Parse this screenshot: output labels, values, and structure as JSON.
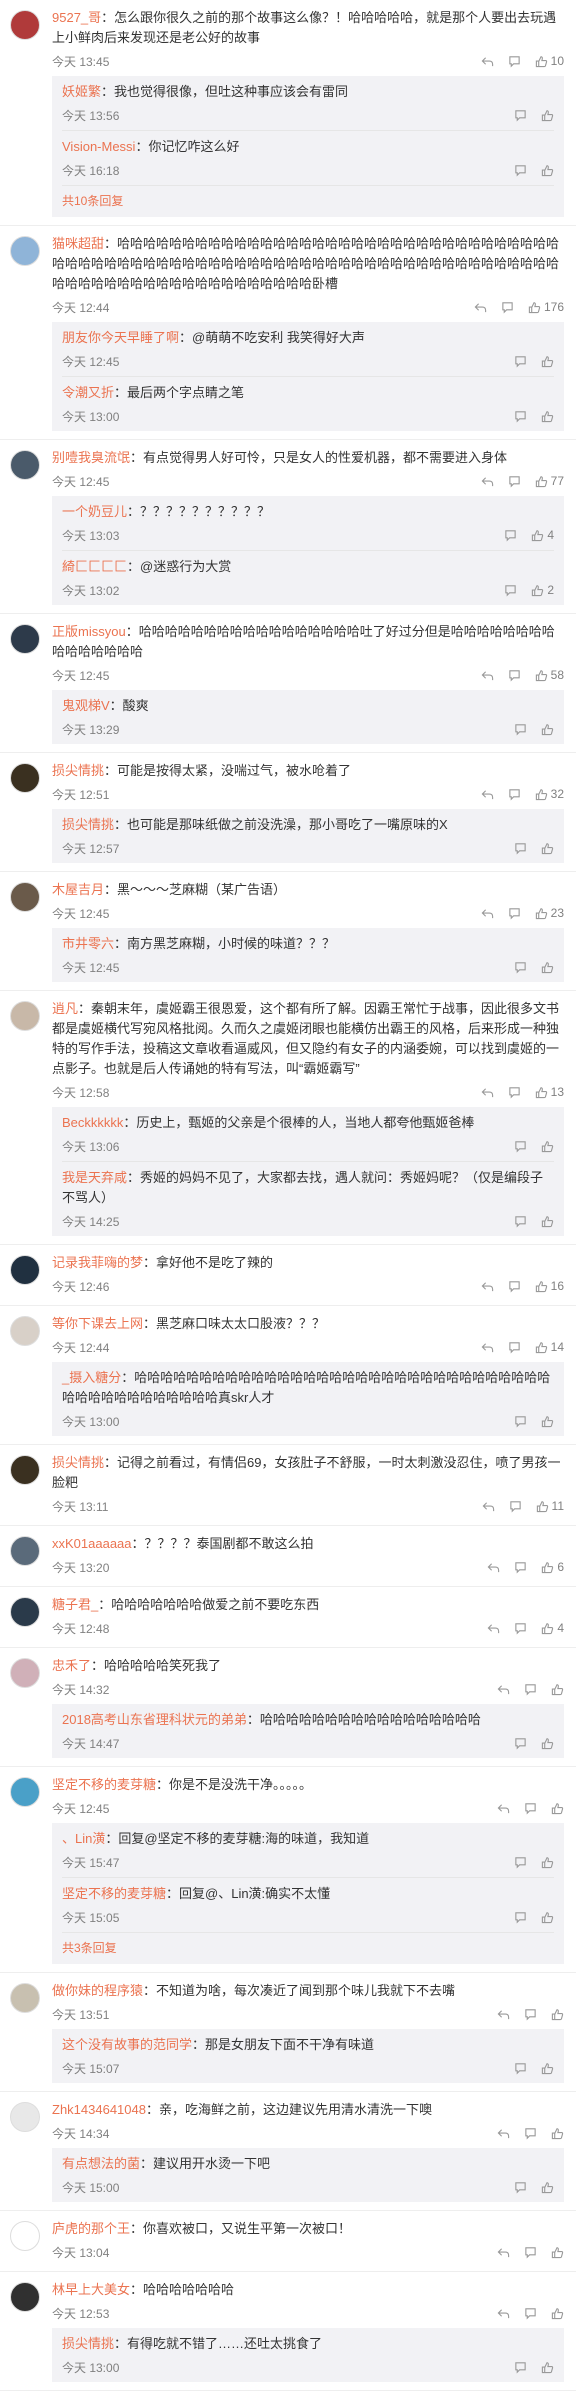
{
  "icons": {
    "reply": "reply-icon",
    "more": "more-icon",
    "like": "thumb-up-icon"
  },
  "comments": [
    {
      "user": "9527_哥",
      "text": "：怎么跟你很久之前的那个故事这么像？！哈哈哈哈哈，就是那个人要出去玩遇上小鲜肉后来发现还是老公好的故事",
      "time": "今天 13:45",
      "likes": "10",
      "avatar_color": "#b03a3a",
      "replies": [
        {
          "user": "妖姬繁",
          "text": "：我也觉得很像，但吐这种事应该会有雷同",
          "time": "今天 13:56"
        },
        {
          "user": "Vision-Messi",
          "text": "：你记忆咋这么好",
          "time": "今天 16:18"
        }
      ],
      "more": "共10条回复"
    },
    {
      "user": "猫咪超甜",
      "text": "：哈哈哈哈哈哈哈哈哈哈哈哈哈哈哈哈哈哈哈哈哈哈哈哈哈哈哈哈哈哈哈哈哈哈哈哈哈哈哈哈哈哈哈哈哈哈哈哈哈哈哈哈哈哈哈哈哈哈哈哈哈哈哈哈哈哈哈哈哈哈哈哈哈哈哈哈哈哈哈哈哈哈哈哈哈哈哈哈哈哈哈哈哈卧槽",
      "time": "今天 12:44",
      "likes": "176",
      "avatar_color": "#8fb4d8",
      "replies": [
        {
          "user": "朋友你今天早睡了啊",
          "text": "：@萌萌不吃安利 我笑得好大声",
          "time": "今天 12:45"
        },
        {
          "user": "令潮又折",
          "text": "：最后两个字点睛之笔",
          "time": "今天 13:00"
        }
      ],
      "more": ""
    },
    {
      "user": "别噎我臭流氓",
      "text": "：有点觉得男人好可怜，只是女人的性爱机器，都不需要进入身体",
      "time": "今天 12:45",
      "likes": "77",
      "avatar_color": "#4a5a6a",
      "replies": [
        {
          "user": "一个奶豆儿",
          "text": "：？？？？？？？？？？",
          "time": "今天 13:03",
          "likes": "4"
        },
        {
          "user": "綺匚匚匚匚",
          "text": "：@迷惑行为大赏",
          "time": "今天 13:02",
          "likes": "2"
        }
      ],
      "more": ""
    },
    {
      "user": "正版missyou",
      "text": "：哈哈哈哈哈哈哈哈哈哈哈哈哈哈哈哈哈吐了好过分但是哈哈哈哈哈哈哈哈哈哈哈哈哈哈哈",
      "time": "今天 12:45",
      "likes": "58",
      "avatar_color": "#2d3a4a",
      "replies": [
        {
          "user": "鬼观梯V",
          "text": "：酸爽",
          "time": "今天 13:29"
        }
      ],
      "more": ""
    },
    {
      "user": "损尖情挑",
      "text": "：可能是按得太紧，没喘过气，被水呛着了",
      "time": "今天 12:51",
      "likes": "32",
      "avatar_color": "#3a3020",
      "replies": [
        {
          "user": "损尖情挑",
          "text": "：也可能是那味纸做之前没洗澡，那小哥吃了一嘴原味的X",
          "time": "今天 12:57"
        }
      ],
      "more": ""
    },
    {
      "user": "木屋吉月",
      "text": "：黑～～～芝麻糊（某广告语）",
      "time": "今天 12:45",
      "likes": "23",
      "avatar_color": "#6a5a4a",
      "replies": [
        {
          "user": "市井零六",
          "text": "：南方黑芝麻糊，小时候的味道？？？",
          "time": "今天 12:45"
        }
      ],
      "more": ""
    },
    {
      "user": "逍凡",
      "text": "：秦朝末年，虞姬霸王很恩爱，这个都有所了解。因霸王常忙于战事，因此很多文书都是虞姬横代写宛风格批阅。久而久之虞姬闭眼也能横仿出霸王的风格，后来形成一种独特的写作手法，投稿这文章收看逼威风，但又隐约有女子的内涵委婉，可以找到虞姬的一点影子。也就是后人传诵她的特有写法，叫“霸姬霸写”",
      "time": "今天 12:58",
      "likes": "13",
      "avatar_color": "#c8b8a8",
      "replies": [
        {
          "user": "Beckkkkkk",
          "text": "：历史上，甄姬的父亲是个很棒的人，当地人都夸他甄姬爸棒",
          "time": "今天 13:06"
        },
        {
          "user": "我是天弃咸",
          "text": "：秀姬的妈妈不见了，大家都去找，遇人就问：秀姬妈呢？（仅是编段子不骂人）",
          "time": "今天 14:25"
        }
      ],
      "more": ""
    },
    {
      "user": "记录我菲嗨的梦",
      "text": "：拿好他不是吃了辣的",
      "time": "今天 12:46",
      "likes": "16",
      "avatar_color": "#203040",
      "replies": [],
      "more": ""
    },
    {
      "user": "等你下课去上网",
      "text": "：黑芝麻口味太太口股液？？？",
      "time": "今天 12:44",
      "likes": "14",
      "avatar_color": "#d8d0c8",
      "replies": [
        {
          "user": "_摄入糖分",
          "text": "：哈哈哈哈哈哈哈哈哈哈哈哈哈哈哈哈哈哈哈哈哈哈哈哈哈哈哈哈哈哈哈哈哈哈哈哈哈哈哈哈哈哈哈哈真skr人才",
          "time": "今天 13:00"
        }
      ],
      "more": ""
    },
    {
      "user": "损尖情挑",
      "text": "：记得之前看过，有情侣69，女孩肚子不舒服，一时太刺激没忍住，喷了男孩一脸粑",
      "time": "今天 13:11",
      "likes": "11",
      "avatar_color": "#3a3020",
      "replies": [],
      "more": ""
    },
    {
      "user": "xxK01aaaaaa",
      "text": "：？？？？泰国剧都不敢这么拍",
      "time": "今天 13:20",
      "likes": "6",
      "avatar_color": "#5a6a7a",
      "replies": [],
      "more": ""
    },
    {
      "user": "糖子君_",
      "text": "：哈哈哈哈哈哈哈做爱之前不要吃东西",
      "time": "今天 12:48",
      "likes": "4",
      "avatar_color": "#2a3a4a",
      "replies": [],
      "more": ""
    },
    {
      "user": "忠禾了",
      "text": "：哈哈哈哈哈笑死我了",
      "time": "今天 14:32",
      "likes": "",
      "avatar_color": "#d0b0b8",
      "replies": [
        {
          "user": "2018高考山东省理科状元的弟弟",
          "text": "：哈哈哈哈哈哈哈哈哈哈哈哈哈哈哈哈哈",
          "time": "今天 14:47"
        }
      ],
      "more": ""
    },
    {
      "user": "坚定不移的麦芽糖",
      "text": "：你是不是没洗干净。。。。。",
      "time": "今天 12:45",
      "likes": "",
      "avatar_color": "#4aa0c8",
      "replies": [
        {
          "user": "、Lin潢",
          "text": "：回复@坚定不移的麦芽糖:海的味道，我知道",
          "time": "今天 15:47"
        },
        {
          "user": "坚定不移的麦芽糖",
          "text": "：回复@、Lin潢:确实不太懂",
          "time": "今天 15:05"
        }
      ],
      "more": "共3条回复"
    },
    {
      "user": "做你妹的程序猿",
      "text": "：不知道为啥，每次凑近了闻到那个味儿我就下不去嘴",
      "time": "今天 13:51",
      "likes": "",
      "avatar_color": "#c8c0b0",
      "replies": [
        {
          "user": "这个没有故事的范同学",
          "text": "：那是女朋友下面不干净有味道",
          "time": "今天 15:07"
        }
      ],
      "more": ""
    },
    {
      "user": "Zhk1434641048",
      "text": "：亲，吃海鲜之前，这边建议先用清水清洗一下噢",
      "time": "今天 14:34",
      "likes": "",
      "avatar_color": "#e8e8e8",
      "replies": [
        {
          "user": "有点想法的菌",
          "text": "：建议用开水烫一下吧",
          "time": "今天 15:00"
        }
      ],
      "more": ""
    },
    {
      "user": "庐虎的那个王",
      "text": "：你喜欢被口，又说生平第一次被口！",
      "time": "今天 13:04",
      "likes": "",
      "avatar_color": "#ffffff",
      "replies": [],
      "more": ""
    },
    {
      "user": "林早上大美女",
      "text": "：哈哈哈哈哈哈哈",
      "time": "今天 12:53",
      "likes": "",
      "avatar_color": "#303030",
      "replies": [
        {
          "user": "损尖情挑",
          "text": "：有得吃就不错了……还吐太挑食了",
          "time": "今天 13:00"
        }
      ],
      "more": ""
    }
  ]
}
